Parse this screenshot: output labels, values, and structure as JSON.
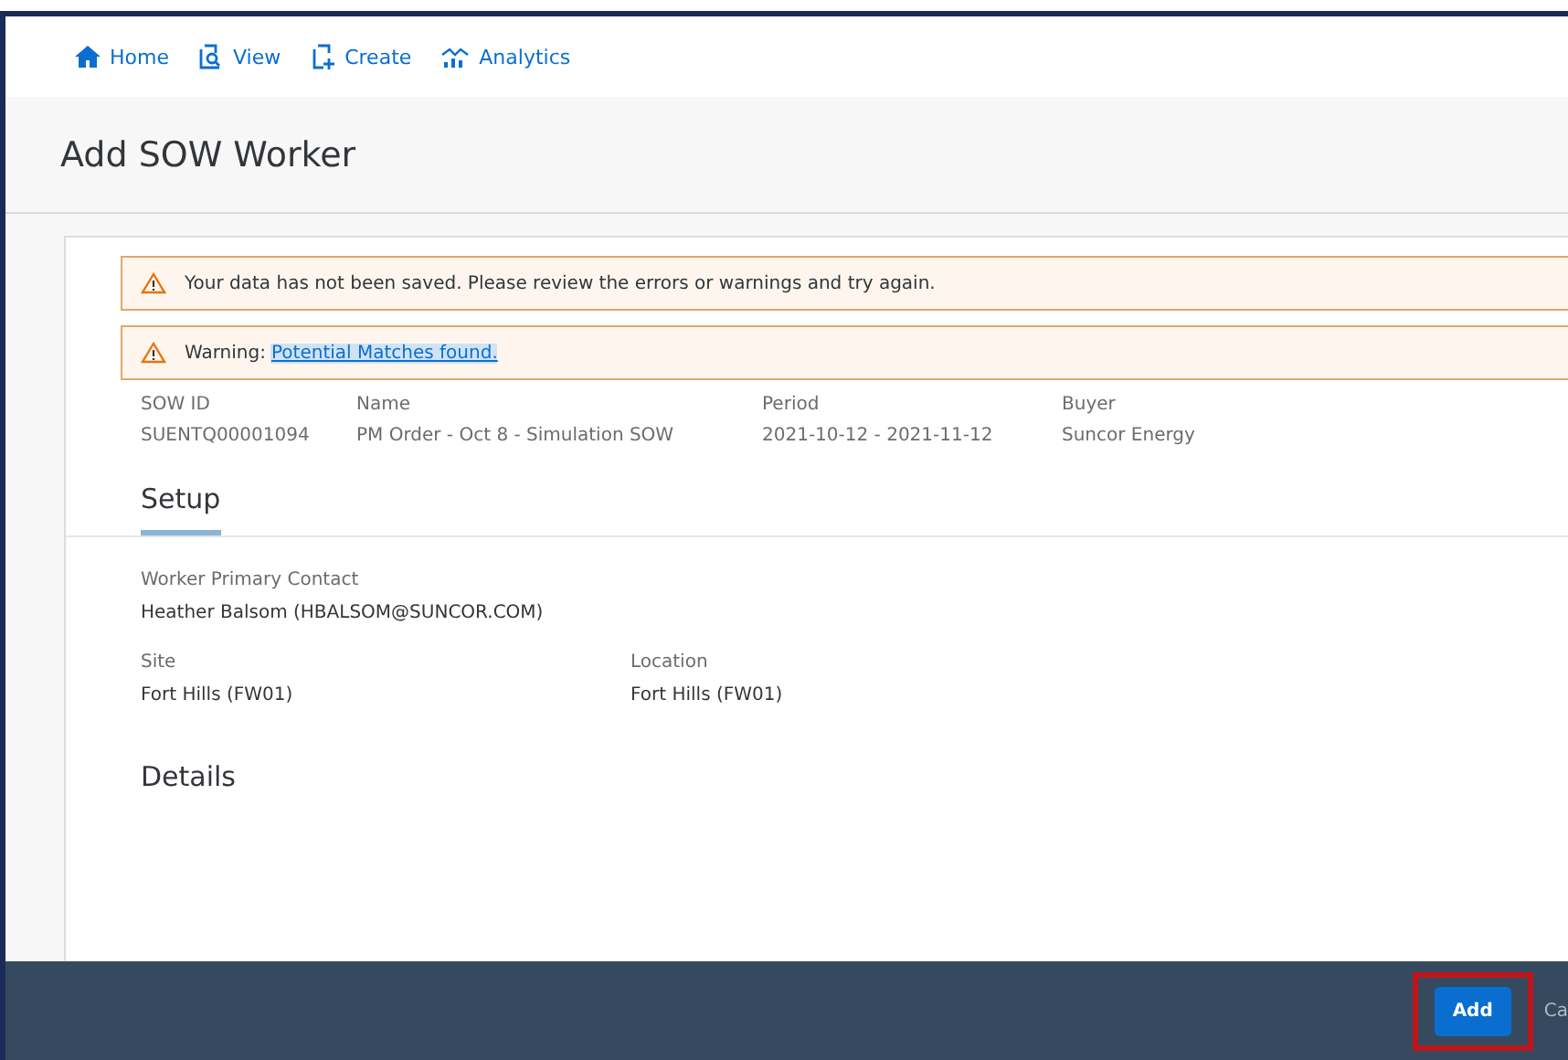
{
  "nav": [
    {
      "label": "Home"
    },
    {
      "label": "View"
    },
    {
      "label": "Create"
    },
    {
      "label": "Analytics"
    }
  ],
  "page_title": "Add SOW Worker",
  "messages": [
    {
      "text": "Your data has not been saved. Please review the errors or warnings and try again."
    },
    {
      "text": "Warning:",
      "link": "Potential Matches found."
    }
  ],
  "summary": [
    {
      "label": "SOW ID",
      "value": "SUENTQ00001094"
    },
    {
      "label": "Name",
      "value": "PM Order - Oct 8 - Simulation SOW"
    },
    {
      "label": "Period",
      "value": "2021-10-12 - 2021-11-12"
    },
    {
      "label": "Buyer",
      "value": "Suncor Energy"
    }
  ],
  "tabs": [
    {
      "label": "Setup",
      "selected": true
    }
  ],
  "setup": {
    "rows": [
      [
        {
          "label": "Worker Primary Contact",
          "value": "Heather Balsom (HBALSOM@SUNCOR.COM)"
        }
      ],
      [
        {
          "label": "Site",
          "value": "Fort Hills (FW01)"
        },
        {
          "label": "Location",
          "value": "Fort Hills (FW01)"
        }
      ]
    ]
  },
  "section_heading": "Details",
  "footer": {
    "primary": "Add",
    "highlighted": true,
    "secondary": "Ca"
  }
}
